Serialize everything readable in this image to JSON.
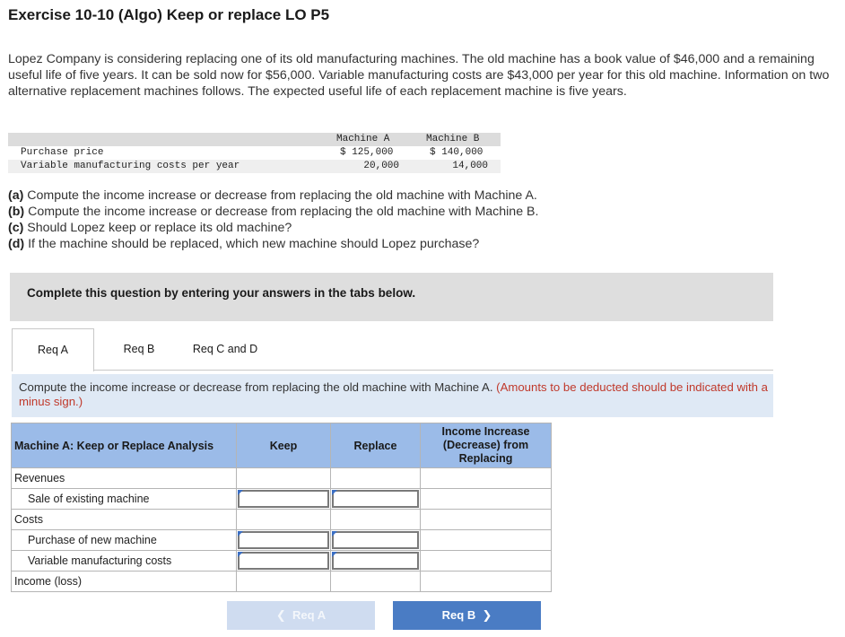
{
  "title": "Exercise 10-10 (Algo) Keep or replace LO P5",
  "intro": "Lopez Company is considering replacing one of its old manufacturing machines. The old machine has a book value of $46,000 and a remaining useful life of five years. It can be sold now for $56,000. Variable manufacturing costs are $43,000 per year for this old machine. Information on two alternative replacement machines follows. The expected useful life of each replacement machine is five years.",
  "data_table": {
    "col_a": "Machine A",
    "col_b": "Machine B",
    "rows": [
      {
        "label": "Purchase price",
        "a": "$ 125,000",
        "b": "$ 140,000"
      },
      {
        "label": "Variable manufacturing costs per year",
        "a": "20,000",
        "b": "14,000"
      }
    ]
  },
  "requirements": [
    {
      "tag": "(a)",
      "text": " Compute the income increase or decrease from replacing the old machine with Machine A."
    },
    {
      "tag": "(b)",
      "text": " Compute the income increase or decrease from replacing the old machine with Machine B."
    },
    {
      "tag": "(c)",
      "text": " Should Lopez keep or replace its old machine?"
    },
    {
      "tag": "(d)",
      "text": " If the machine should be replaced, which new machine should Lopez purchase?"
    }
  ],
  "instruction": "Complete this question by entering your answers in the tabs below.",
  "tabs": [
    {
      "label": "Req A"
    },
    {
      "label": "Req B"
    },
    {
      "label": "Req C and D"
    }
  ],
  "question": {
    "text": "Compute the income increase or decrease from replacing the old machine with Machine A. ",
    "note": "(Amounts to be deducted should be indicated with a minus sign.)"
  },
  "analysis_table": {
    "headers": {
      "c1": "Machine A: Keep or Replace Analysis",
      "c2": "Keep",
      "c3": "Replace",
      "c4": "Income Increase (Decrease) from Replacing"
    },
    "rows": {
      "revenues": "Revenues",
      "sale": "Sale of existing machine",
      "costs": "Costs",
      "purchase": "Purchase of new machine",
      "variable": "Variable manufacturing costs",
      "income": "Income (loss)"
    },
    "inputs": {
      "sale_keep": "",
      "sale_replace": "",
      "purchase_keep": "",
      "purchase_replace": "",
      "variable_keep": "",
      "variable_replace": ""
    }
  },
  "nav": {
    "prev_label": "Req A",
    "next_label": "Req B"
  }
}
